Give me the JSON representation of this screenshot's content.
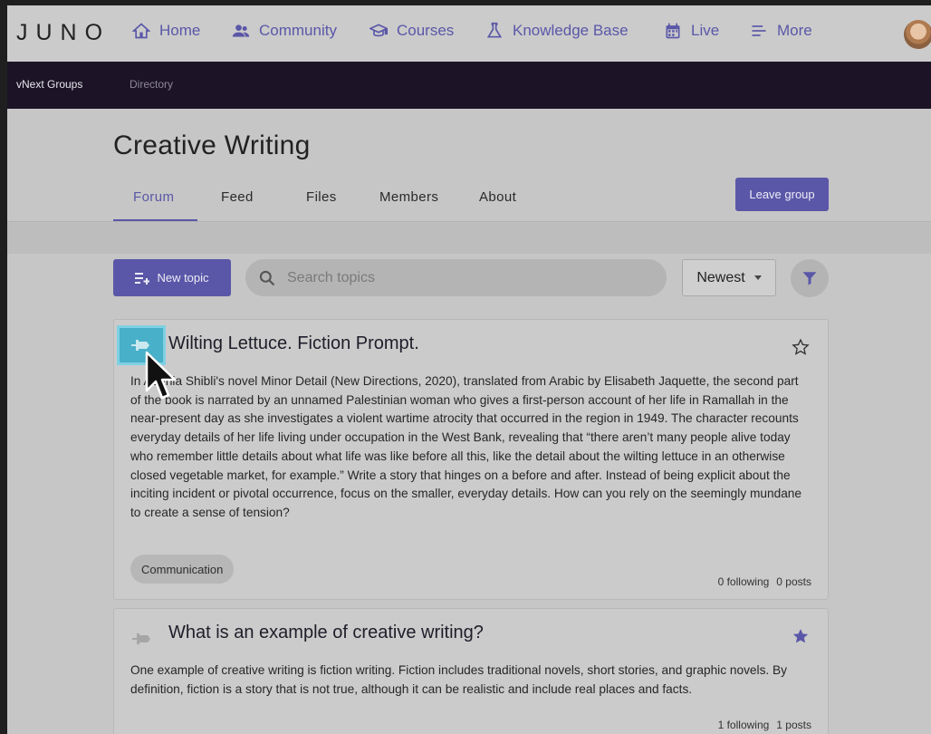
{
  "logo": "JUNO",
  "nav": {
    "items": [
      {
        "label": "Home",
        "icon": "home-icon"
      },
      {
        "label": "Community",
        "icon": "people-icon"
      },
      {
        "label": "Courses",
        "icon": "graduation-cap-icon"
      },
      {
        "label": "Knowledge Base",
        "icon": "flask-icon"
      },
      {
        "label": "Live",
        "icon": "calendar-icon"
      },
      {
        "label": "More",
        "icon": "menu-icon"
      }
    ]
  },
  "subnav": {
    "groups_label": "vNext Groups",
    "directory_label": "Directory"
  },
  "group": {
    "title": "Creative Writing",
    "tabs": [
      "Forum",
      "Feed",
      "Files",
      "Members",
      "About"
    ],
    "active_tab": "Forum",
    "leave_label": "Leave group"
  },
  "toolbar": {
    "new_topic_label": "New topic",
    "search_placeholder": "Search topics",
    "sort_label": "Newest"
  },
  "topics": [
    {
      "title": "Wilting Lettuce. Fiction Prompt.",
      "body": "In Adania Shibli's novel Minor Detail (New Directions, 2020), translated from Arabic by Elisabeth Jaquette, the second part of the book is narrated by an unnamed Palestinian woman who gives a first-person account of her life in Ramallah in the near-present day as she investigates a violent wartime atrocity that occurred in the region in 1949. The character recounts everyday details of her life living under occupation in the West Bank, revealing that “there aren’t many people alive today who remember little details about what life was like before all this, like the detail about the wilting lettuce in an otherwise closed vegetable market, for example.” Write a story that hinges on a before and after. Instead of being explicit about the inciting incident or pivotal occurrence, focus on the smaller, everyday details. How can you rely on the seemingly mundane to create a sense of tension?",
      "tag": "Communication",
      "following": "0 following",
      "posts": "0 posts",
      "starred": false
    },
    {
      "title": "What is an example of creative writing?",
      "body": "One example of creative writing is fiction writing. Fiction includes traditional novels, short stories, and graphic novels. By definition, fiction is a story that is not true, although it can be realistic and include real places and facts.",
      "following": "1 following",
      "posts": "1 posts",
      "starred": true
    }
  ],
  "colors": {
    "accent": "#5a57a8",
    "subnav_bg": "#1c1426",
    "highlight": "#48b0c8"
  }
}
